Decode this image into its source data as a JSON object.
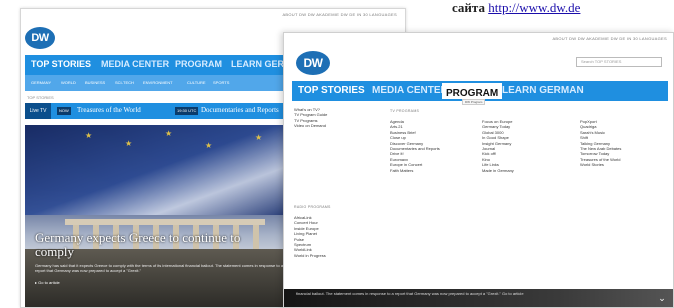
{
  "caption": {
    "text": "сайта ",
    "url": "http://www.dw.de"
  },
  "back": {
    "toplinks": "ABOUT DW   DW AKADEMIE   DW DE IN 30 LANGUAGES",
    "logo": "DW",
    "nav": [
      "TOP STORIES",
      "MEDIA CENTER",
      "PROGRAM",
      "LEARN GERMAN"
    ],
    "subnav": [
      "GERMANY",
      "WORLD",
      "BUSINESS",
      "SCI-TECH",
      "ENVIRONMENT",
      "CULTURE",
      "SPORTS"
    ],
    "crumb": "TOP STORIES",
    "tvbar": {
      "live": "Live TV",
      "badge1": "NOW",
      "prog1": "Treasures of the World",
      "badge2": "19:30 UTC",
      "prog2": "Documentaries and Reports"
    },
    "hero": {
      "headline": "Germany expects Greece to continue to comply",
      "teaser": "Germany has said that it expects Greece to comply with the terms of its international financial bailout. The statement comes in response to a report that Germany was now prepared to accept a \"Grexit.\"",
      "more": "Go to article"
    }
  },
  "front": {
    "toplinks": "ABOUT DW   DW AKADEMIE   DW DE IN 30 LANGUAGES",
    "logo": "DW",
    "search_placeholder": "Search TOP STORIES",
    "nav": [
      "TOP STORIES",
      "MEDIA CENTER",
      "PROGRAM",
      "LEARN GERMAN"
    ],
    "tooltip": "DW Program",
    "left_links": [
      "What's on TV?",
      "TV Program Guide",
      "TV Programs",
      "Video on Demand"
    ],
    "tv_heading": "TV PROGRAMS",
    "tv_col1": [
      "Agenda",
      "Arts.21",
      "Business Brief",
      "Close up",
      "Discover Germany",
      "Documentaries and Reports",
      "Drive it!",
      "Euromaxx",
      "Europe in Concert",
      "Faith Matters"
    ],
    "tv_col2": [
      "Focus on Europe",
      "Germany Today",
      "Global 3000",
      "In Good Shape",
      "Insight Germany",
      "Journal",
      "Kick off!",
      "Kino",
      "Life Links",
      "Made in Germany"
    ],
    "tv_col3": [
      "PopXport",
      "Quadriga",
      "Sarah's Music",
      "Shift",
      "Talking Germany",
      "The New Arab Debates",
      "Tomorrow Today",
      "Treasures of the World",
      "World Stories"
    ],
    "radio_heading": "RADIO PROGRAMS",
    "radio_links": [
      "AfricaLink",
      "Concert Hour",
      "Inside Europe",
      "Living Planet",
      "Pulse",
      "Spectrum",
      "WorldLink",
      "World in Progress"
    ],
    "bottom_text": "financial bailout. The statement comes in response to a report that Germany was now prepared to accept a \"Grexit.\"  Go to article",
    "chevron": "⌄"
  }
}
